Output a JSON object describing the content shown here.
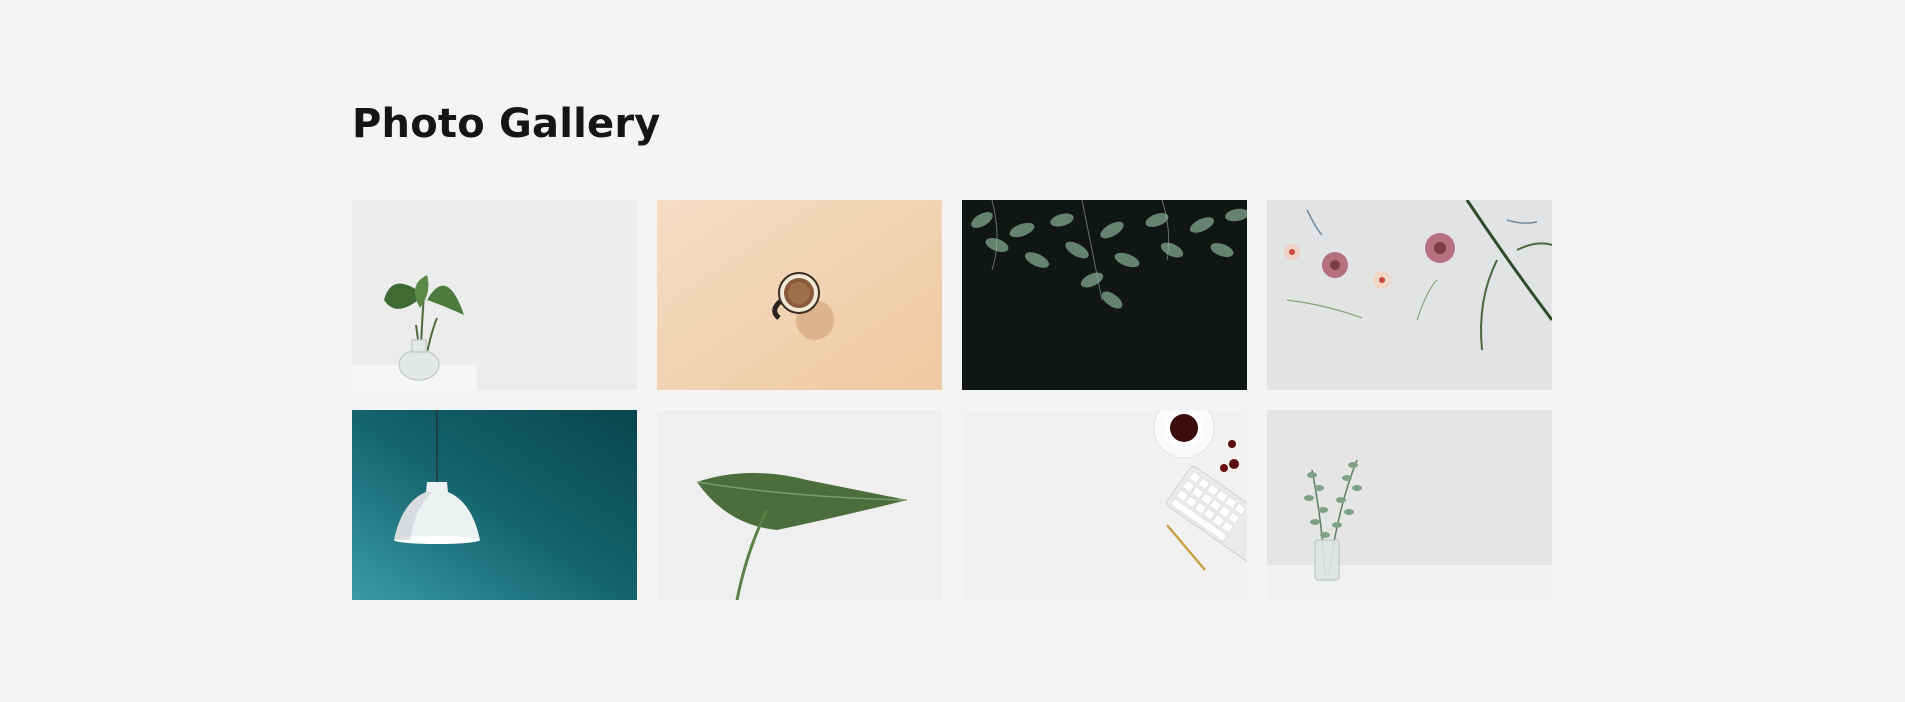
{
  "header": {
    "title": "Photo Gallery"
  },
  "gallery": {
    "photos": [
      {
        "subject": "plant-in-glass-vase"
      },
      {
        "subject": "coffee-cup-on-peach"
      },
      {
        "subject": "dark-foliage"
      },
      {
        "subject": "pressed-flowers-flatlay"
      },
      {
        "subject": "pendant-lamp-teal"
      },
      {
        "subject": "single-green-leaf"
      },
      {
        "subject": "coffee-keyboard-desk"
      },
      {
        "subject": "eucalyptus-in-jar"
      }
    ]
  }
}
